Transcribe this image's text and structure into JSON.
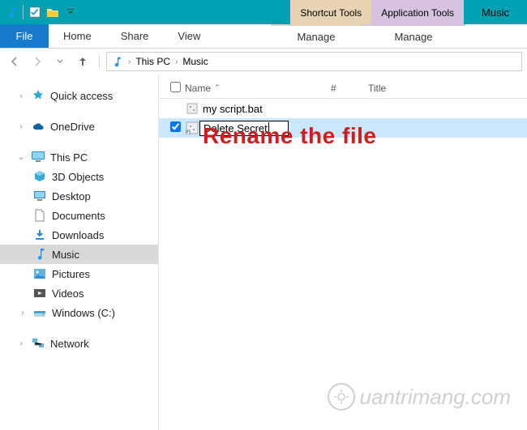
{
  "titlebar": {
    "ctx_shortcut": "Shortcut Tools",
    "ctx_app": "Application Tools",
    "window_title": "Music"
  },
  "ribbon": {
    "file": "File",
    "tabs": [
      "Home",
      "Share",
      "View"
    ],
    "manage1": "Manage",
    "manage2": "Manage"
  },
  "breadcrumb": {
    "root": "This PC",
    "current": "Music"
  },
  "columns": {
    "name": "Name",
    "num": "#",
    "title": "Title"
  },
  "files": [
    {
      "name": "my script.bat",
      "selected": false,
      "renaming": false
    },
    {
      "name": "Delete Secret",
      "selected": true,
      "renaming": true
    }
  ],
  "nav": {
    "quick_access": "Quick access",
    "onedrive": "OneDrive",
    "this_pc": "This PC",
    "children": [
      "3D Objects",
      "Desktop",
      "Documents",
      "Downloads",
      "Music",
      "Pictures",
      "Videos",
      "Windows (C:)"
    ],
    "network": "Network"
  },
  "annotation": "Rename the file",
  "watermark": "uantrimang.com"
}
